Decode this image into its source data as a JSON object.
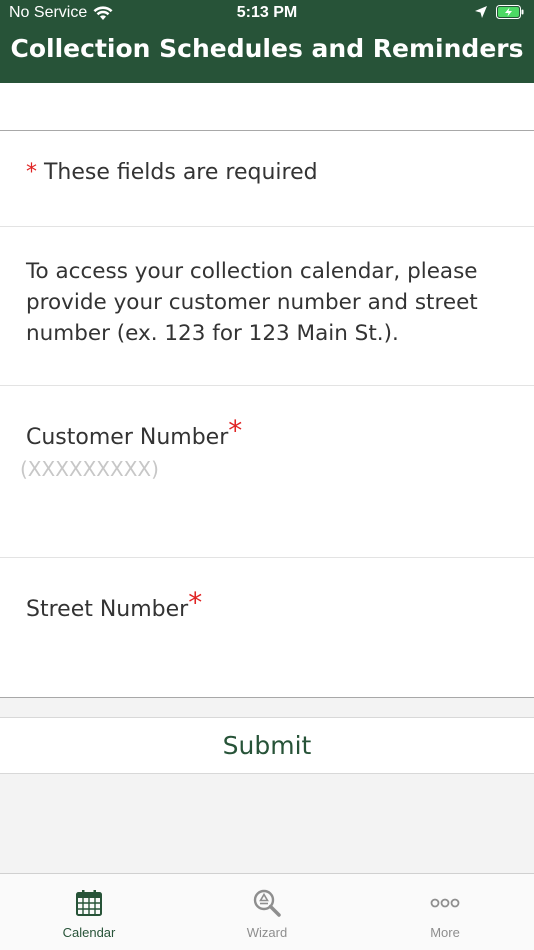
{
  "status_bar": {
    "carrier": "No Service",
    "time": "5:13 PM"
  },
  "header": {
    "title": "Collection Schedules and Reminders"
  },
  "form": {
    "required_asterisk": "*",
    "required_note": " These fields are required",
    "intro": "To access your collection calendar, please provide your customer number and street number (ex. 123 for 123 Main St.).",
    "customer_number": {
      "label": "Customer Number",
      "asterisk": "*",
      "value": "",
      "placeholder": "(XXXXXXXXX)"
    },
    "street_number": {
      "label": "Street Number",
      "asterisk": "*",
      "value": "",
      "placeholder": ""
    },
    "submit_label": "Submit"
  },
  "tabs": [
    {
      "label": "Calendar",
      "icon": "calendar-icon",
      "active": true
    },
    {
      "label": "Wizard",
      "icon": "recycle-search-icon",
      "active": false
    },
    {
      "label": "More",
      "icon": "more-dots-icon",
      "active": false
    }
  ],
  "colors": {
    "brand_green": "#275338",
    "required_red": "#e02424",
    "battery_green": "#4cd964"
  }
}
